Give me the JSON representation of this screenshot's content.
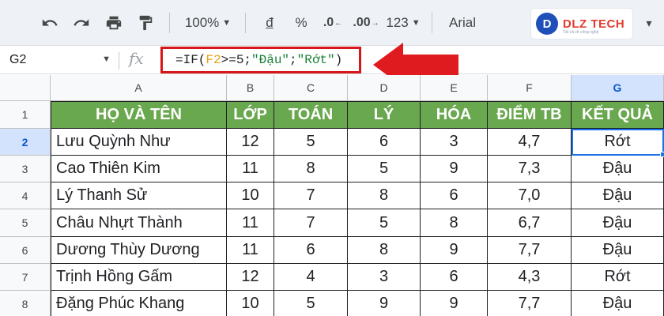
{
  "toolbar": {
    "undo_icon": "undo-icon",
    "redo_icon": "redo-icon",
    "print_icon": "print-icon",
    "paint_format_icon": "paint-format-icon",
    "zoom": "100%",
    "currency": "đ",
    "percent": "%",
    "decrease_decimal": ".0",
    "increase_decimal": ".00",
    "more_formats": "123",
    "font": "Arial"
  },
  "logo": {
    "mark": "D",
    "text": "DLZ TECH",
    "tagline": "Tất cả về công nghệ"
  },
  "formula_bar": {
    "name_box": "G2",
    "fx": "fx",
    "formula_prefix": "=IF(",
    "formula_ref": "F2",
    "formula_op": ">=5;",
    "formula_true": "\"Đậu\"",
    "formula_sep": ";",
    "formula_false": "\"Rớt\"",
    "formula_suffix": ")"
  },
  "columns": [
    "A",
    "B",
    "C",
    "D",
    "E",
    "F",
    "G"
  ],
  "rows": [
    "1",
    "2",
    "3",
    "4",
    "5",
    "6",
    "7",
    "8"
  ],
  "selected_cell": "G2",
  "table": {
    "headers": [
      "HỌ VÀ TÊN",
      "LỚP",
      "TOÁN",
      "LÝ",
      "HÓA",
      "ĐIỂM TB",
      "KẾT QUẢ"
    ],
    "data": [
      [
        "Lưu Quỳnh Như",
        "12",
        "5",
        "6",
        "3",
        "4,7",
        "Rớt"
      ],
      [
        "Cao Thiên Kim",
        "11",
        "8",
        "5",
        "9",
        "7,3",
        "Đậu"
      ],
      [
        "Lý Thanh Sử",
        "10",
        "7",
        "8",
        "6",
        "7,0",
        "Đậu"
      ],
      [
        "Châu Nhựt Thành",
        "11",
        "7",
        "5",
        "8",
        "6,7",
        "Đậu"
      ],
      [
        "Dương Thùy Dương",
        "11",
        "6",
        "8",
        "9",
        "7,7",
        "Đậu"
      ],
      [
        "Trịnh Hồng Gấm",
        "12",
        "4",
        "3",
        "6",
        "4,3",
        "Rớt"
      ],
      [
        "Đặng Phúc Khang",
        "10",
        "5",
        "9",
        "9",
        "7,7",
        "Đậu"
      ]
    ]
  },
  "colors": {
    "header_green": "#6aa84f",
    "highlight_red": "#d6161b",
    "selection_blue": "#1a73e8"
  }
}
